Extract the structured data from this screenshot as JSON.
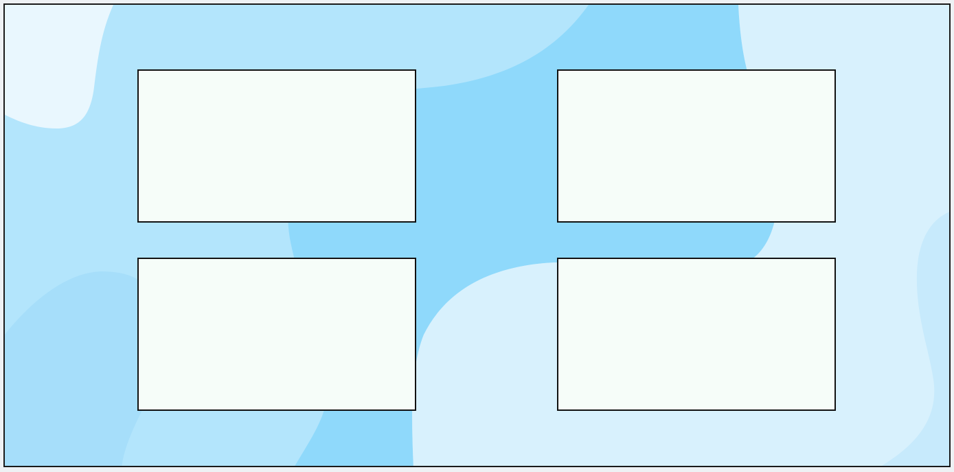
{
  "canvas": {
    "colors": {
      "base": "#b3e5fc",
      "light_blob": "#e8f6fd",
      "mid_blob": "#8fd9fb",
      "pale_blob": "#d8f1fd",
      "card_fill": "#f6fdf9",
      "card_border": "#111111",
      "frame_border": "#1a1a1a"
    },
    "cards": [
      {
        "id": "card-1",
        "text": ""
      },
      {
        "id": "card-2",
        "text": ""
      },
      {
        "id": "card-3",
        "text": ""
      },
      {
        "id": "card-4",
        "text": ""
      }
    ]
  }
}
